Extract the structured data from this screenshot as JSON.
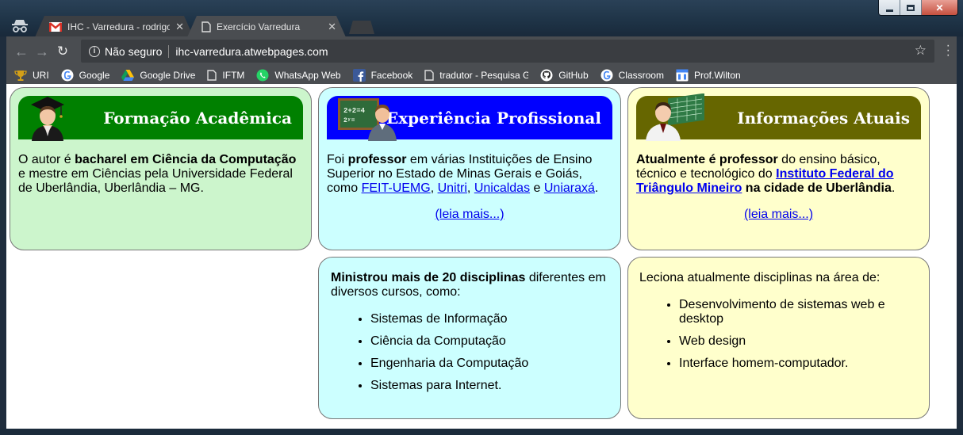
{
  "window": {
    "minimize_icon": "minimize-icon",
    "maximize_icon": "maximize-icon",
    "close_label": "✕"
  },
  "tabs": [
    {
      "title": "IHC - Varredura - rodrigo",
      "icon": "gmail-icon",
      "close": "✕"
    },
    {
      "title": "Exercício Varredura",
      "icon": "page-icon",
      "close": "✕"
    }
  ],
  "toolbar": {
    "security_label": "Não seguro",
    "url": "ihc-varredura.atwebpages.com"
  },
  "bookmarks": [
    {
      "label": "URI",
      "icon": "trophy-icon"
    },
    {
      "label": "Google",
      "icon": "google-icon"
    },
    {
      "label": "Google Drive",
      "icon": "drive-icon"
    },
    {
      "label": "IFTM",
      "icon": "page-icon"
    },
    {
      "label": "WhatsApp Web",
      "icon": "whatsapp-icon"
    },
    {
      "label": "Facebook",
      "icon": "facebook-icon"
    },
    {
      "label": "tradutor - Pesquisa G",
      "icon": "page-icon"
    },
    {
      "label": "GitHub",
      "icon": "github-icon"
    },
    {
      "label": "Classroom",
      "icon": "google-icon"
    },
    {
      "label": "Prof.Wilton",
      "icon": "calendar-icon"
    }
  ],
  "cards": {
    "formacao": {
      "title": "Formação Acadêmica",
      "t1": "O autor é ",
      "b1": "bacharel em Ciência da Computação",
      "t2": " e mestre em Ciências pela Universidade Federal de Uberlândia, Uberlândia – MG."
    },
    "experiencia": {
      "title": "Experiência Profissional",
      "t1": "Foi ",
      "b1": "professor",
      "t2": " em várias Instituições de Ensino Superior no Estado de Minas Gerais e Goiás, como ",
      "link1": "FEIT-UEMG",
      "sep1": ", ",
      "link2": "Unitri",
      "sep2": ", ",
      "link3": "Unicaldas",
      "sep3": " e ",
      "link4": "Uniaraxá",
      "end": ".",
      "more": "(leia mais...)"
    },
    "atuais": {
      "title": "Informações Atuais",
      "b1": "Atualmente é professor",
      "t1": " do ensino básico, técnico e tecnológico do ",
      "link1": "Instituto Federal do Triângulo Mineiro",
      "b2": " na cidade de Uberlândia",
      "end": ".",
      "more": "(leia mais...)"
    },
    "disciplinas": {
      "b1": "Ministrou mais de 20 disciplinas",
      "t1": " diferentes em diversos cursos, como:",
      "items": [
        "Sistemas de Informação",
        "Ciência da Computação",
        "Engenharia da Computação",
        "Sistemas para Internet."
      ]
    },
    "leciona": {
      "t1": "Leciona atualmente disciplinas na área de:",
      "items": [
        "Desenvolvimento de sistemas web e desktop",
        "Web design",
        "Interface homem-computador."
      ]
    }
  },
  "colors": {
    "green_card": "#ccf5cc",
    "cyan_card": "#ccffff",
    "yellow_card": "#ffffcc",
    "green_header": "#008000",
    "blue_header": "#0000ff",
    "olive_header": "#666600"
  }
}
